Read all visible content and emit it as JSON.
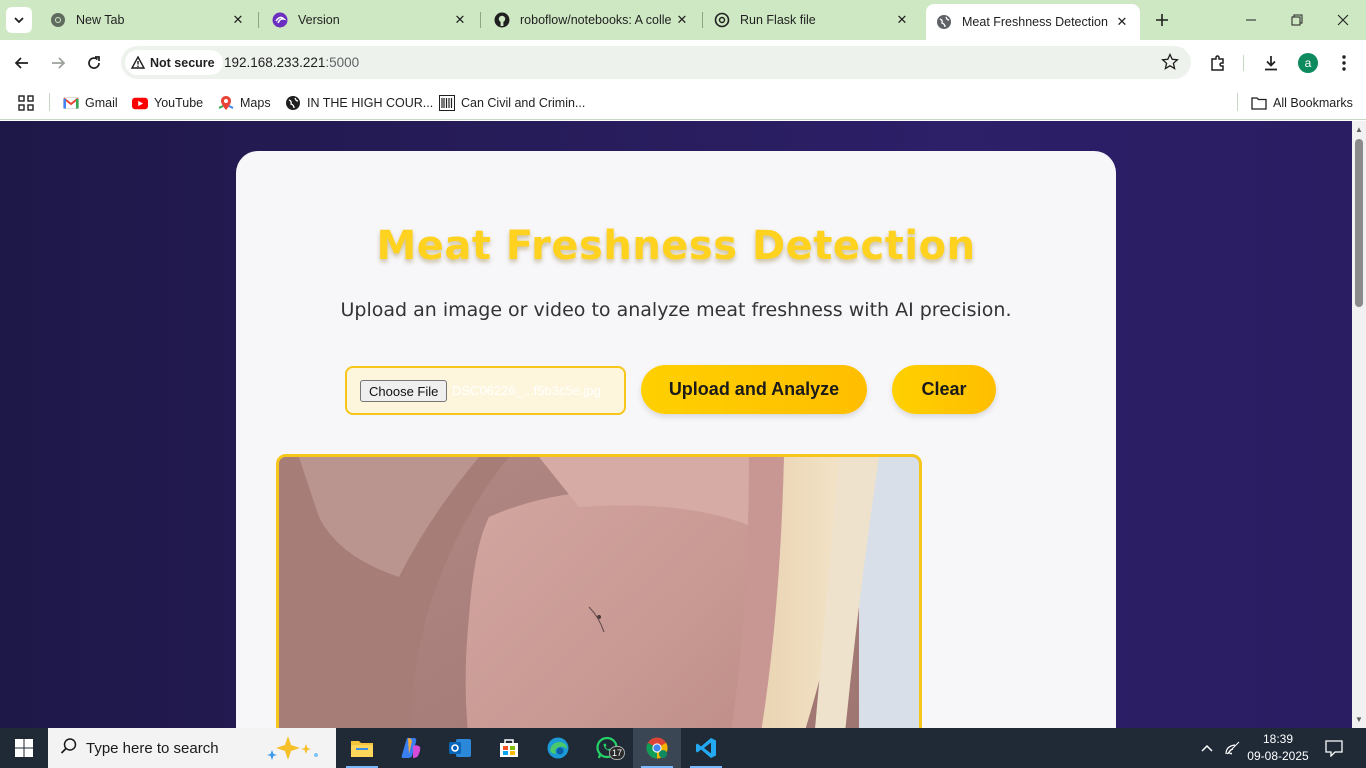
{
  "browser": {
    "tabs": [
      {
        "title": "New Tab",
        "icon": "chrome-icon"
      },
      {
        "title": "Version",
        "icon": "version-app-icon"
      },
      {
        "title": "roboflow/notebooks: A colle",
        "icon": "github-icon"
      },
      {
        "title": "Run Flask file",
        "icon": "chatgpt-icon"
      },
      {
        "title": "Meat Freshness Detection",
        "icon": "globe-icon",
        "active": true
      }
    ],
    "security_label": "Not secure",
    "url_host": "192.168.233.221",
    "url_port": ":5000",
    "profile_initial": "a",
    "bookmarks": [
      {
        "label": "Gmail",
        "icon": "gmail-icon"
      },
      {
        "label": "YouTube",
        "icon": "youtube-icon"
      },
      {
        "label": "Maps",
        "icon": "maps-icon"
      },
      {
        "label": "IN THE HIGH COUR...",
        "icon": "globe-icon"
      },
      {
        "label": "Can Civil and Crimin...",
        "icon": "barcode-icon"
      }
    ],
    "all_bookmarks_label": "All Bookmarks"
  },
  "page": {
    "title": "Meat Freshness Detection",
    "subtitle": "Upload an image or video to analyze meat freshness with AI precision.",
    "choose_file_label": "Choose File",
    "file_name": "DSC06226_...f5b3c5e.jpg",
    "upload_button": "Upload and Analyze",
    "clear_button": "Clear",
    "accent_color": "#ffd21f",
    "background_color": "#271c5a"
  },
  "taskbar": {
    "search_placeholder": "Type here to search",
    "whatsapp_badge": "17",
    "time": "18:39",
    "date": "09-08-2025"
  }
}
